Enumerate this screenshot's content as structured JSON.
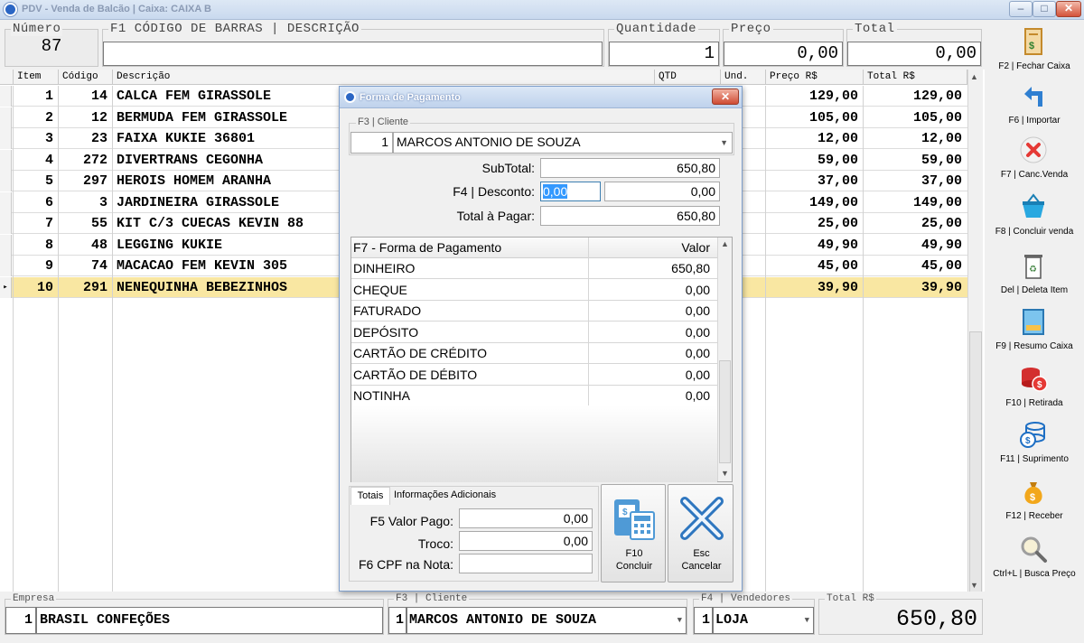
{
  "window": {
    "title": "PDV - Venda de Balcão | Caixa: CAIXA B",
    "min": "–",
    "max": "□",
    "close": "✕"
  },
  "header": {
    "numero_label": "Número",
    "numero_value": "87",
    "barcode_label": "F1 CÓDIGO DE BARRAS | DESCRIÇÃO",
    "barcode_value": "",
    "quantidade_label": "Quantidade",
    "quantidade_value": "1",
    "preco_label": "Preço",
    "preco_value": "0,00",
    "total_label": "Total",
    "total_value": "0,00"
  },
  "grid": {
    "columns": [
      "Item",
      "Código",
      "Descrição",
      "QTD",
      "Und.",
      "Preço R$",
      "Total R$"
    ],
    "rows": [
      {
        "item": "1",
        "codigo": "14",
        "descricao": "CALCA FEM GIRASSOLE",
        "preco": "129,00",
        "total": "129,00"
      },
      {
        "item": "2",
        "codigo": "12",
        "descricao": "BERMUDA FEM GIRASSOLE",
        "preco": "105,00",
        "total": "105,00"
      },
      {
        "item": "3",
        "codigo": "23",
        "descricao": "FAIXA KUKIE 36801",
        "preco": "12,00",
        "total": "12,00"
      },
      {
        "item": "4",
        "codigo": "272",
        "descricao": "DIVERTRANS CEGONHA",
        "preco": "59,00",
        "total": "59,00"
      },
      {
        "item": "5",
        "codigo": "297",
        "descricao": "HEROIS HOMEM ARANHA",
        "preco": "37,00",
        "total": "37,00"
      },
      {
        "item": "6",
        "codigo": "3",
        "descricao": "JARDINEIRA GIRASSOLE",
        "preco": "149,00",
        "total": "149,00"
      },
      {
        "item": "7",
        "codigo": "55",
        "descricao": "KIT C/3 CUECAS KEVIN 88",
        "preco": "25,00",
        "total": "25,00"
      },
      {
        "item": "8",
        "codigo": "48",
        "descricao": "LEGGING KUKIE",
        "preco": "49,90",
        "total": "49,90"
      },
      {
        "item": "9",
        "codigo": "74",
        "descricao": "MACACAO FEM KEVIN 305",
        "preco": "45,00",
        "total": "45,00"
      },
      {
        "item": "10",
        "codigo": "291",
        "descricao": "NENEQUINHA BEBEZINHOS",
        "preco": "39,90",
        "total": "39,90"
      }
    ],
    "selected_marker": "▸"
  },
  "sidebar": {
    "items": [
      {
        "label": "F2 | Fechar Caixa",
        "icon": "receipt-icon"
      },
      {
        "label": "F6 | Importar",
        "icon": "import-arrow-icon"
      },
      {
        "label": "F7 | Canc.Venda",
        "icon": "cancel-icon"
      },
      {
        "label": "F8 | Concluir venda",
        "icon": "basket-icon"
      },
      {
        "label": "Del | Deleta Item",
        "icon": "trash-icon"
      },
      {
        "label": "F9 | Resumo Caixa",
        "icon": "summary-icon"
      },
      {
        "label": "F10 | Retirada",
        "icon": "coins-out-icon"
      },
      {
        "label": "F11 | Suprimento",
        "icon": "coins-in-icon"
      },
      {
        "label": "F12  | Receber",
        "icon": "money-bag-icon"
      },
      {
        "label": "Ctrl+L | Busca Preço",
        "icon": "price-search-icon"
      }
    ]
  },
  "footer": {
    "empresa_label": "Empresa",
    "empresa_code": "1",
    "empresa_name": "BRASIL CONFEÇÕES",
    "cliente_label": "F3 | Cliente",
    "cliente_code": "1",
    "cliente_name": "MARCOS ANTONIO DE SOUZA",
    "vendedores_label": "F4 | Vendedores",
    "vendedor_code": "1",
    "vendedor_name": "LOJA",
    "total_label": "Total R$",
    "total_value": "650,80"
  },
  "dialog": {
    "title": "Forma de Pagamento",
    "close": "✕",
    "cliente_group_label": "F3 | Cliente",
    "cliente_code": "1",
    "cliente_name": "MARCOS ANTONIO DE SOUZA",
    "subtotal_label": "SubTotal:",
    "subtotal_value": "650,80",
    "desconto_label": "F4 | Desconto:",
    "desconto_pct": "0,00",
    "desconto_value": "0,00",
    "total_pagar_label": "Total à Pagar:",
    "total_pagar_value": "650,80",
    "fp_header_name": "F7 - Forma de Pagamento",
    "fp_header_value": "Valor",
    "formas": [
      {
        "nome": "DINHEIRO",
        "valor": "650,80"
      },
      {
        "nome": "CHEQUE",
        "valor": "0,00"
      },
      {
        "nome": "FATURADO",
        "valor": "0,00"
      },
      {
        "nome": "DEPÓSITO",
        "valor": "0,00"
      },
      {
        "nome": "CARTÃO DE CRÉDITO",
        "valor": "0,00"
      },
      {
        "nome": "CARTÃO DE DÉBITO",
        "valor": "0,00"
      },
      {
        "nome": "NOTINHA",
        "valor": "0,00"
      }
    ],
    "tab_totais": "Totais",
    "tab_info": "Informações Adicionais",
    "valor_pago_label": "F5 Valor Pago:",
    "valor_pago_value": "0,00",
    "troco_label": "Troco:",
    "troco_value": "0,00",
    "cpf_label": "F6 CPF na Nota:",
    "cpf_value": "",
    "concluir_line1": "F10",
    "concluir_line2": "Concluir",
    "cancelar_line1": "Esc",
    "cancelar_line2": "Cancelar"
  }
}
